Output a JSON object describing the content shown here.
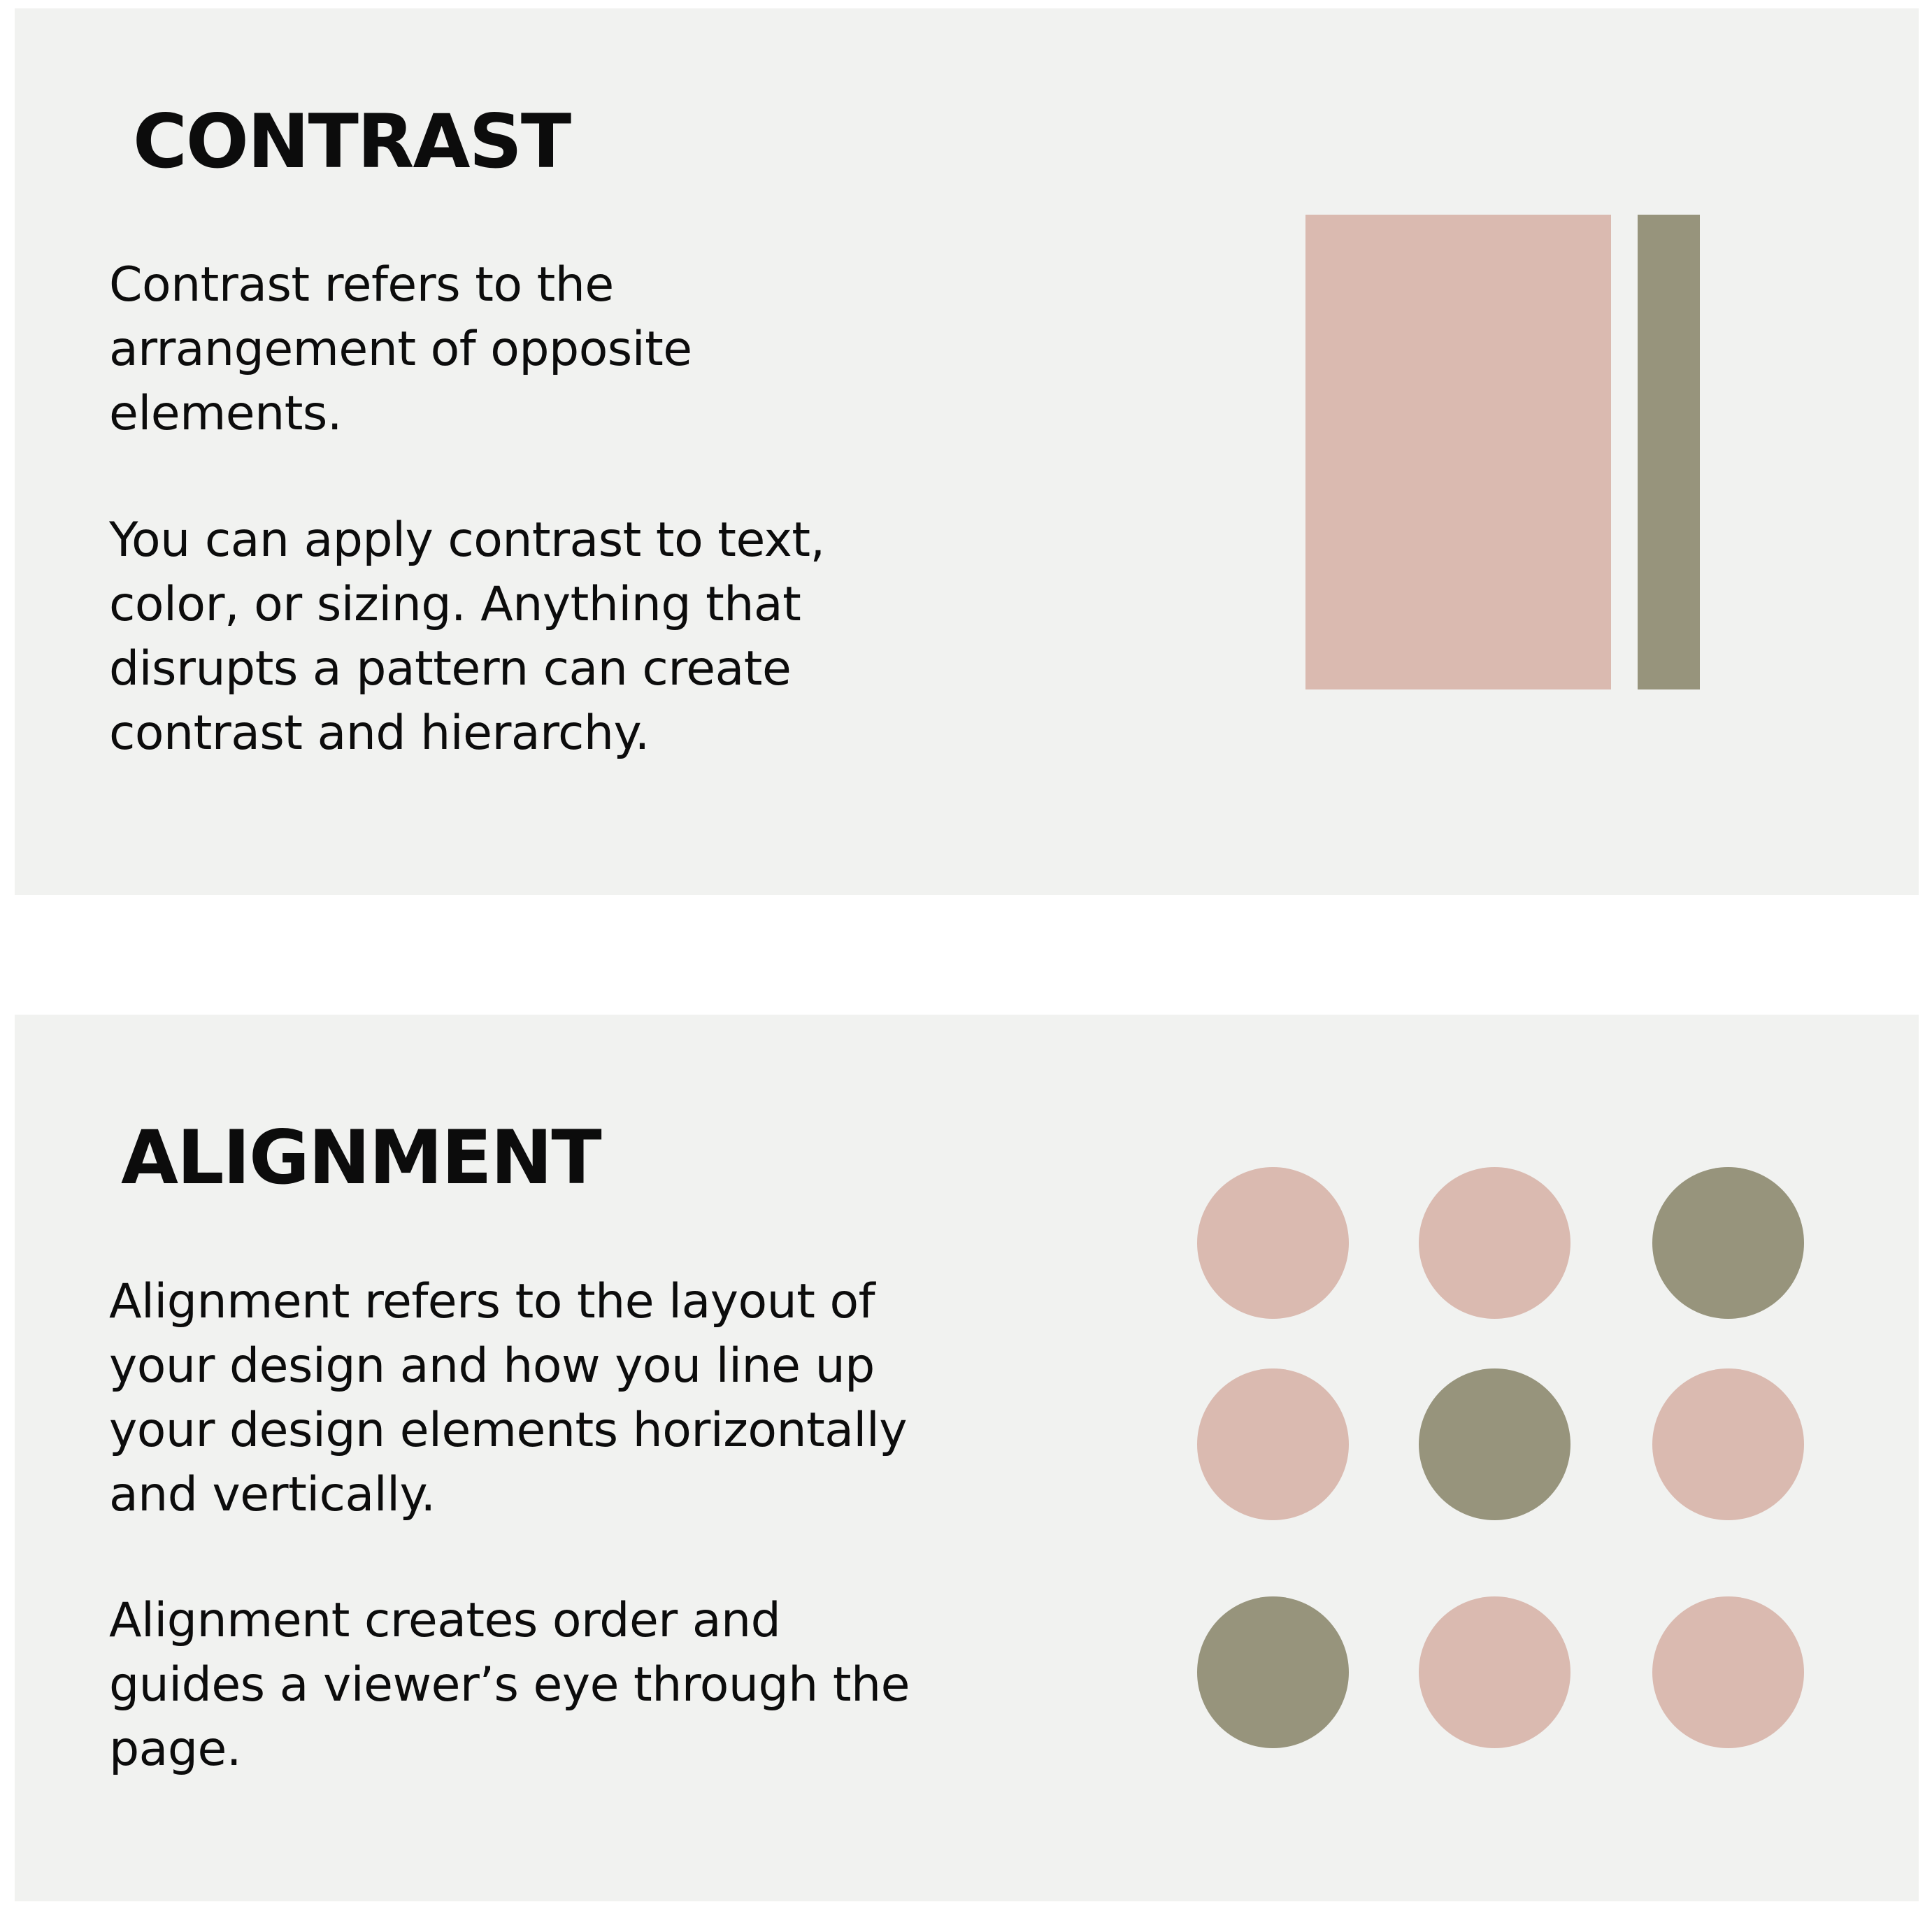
{
  "colors": {
    "panel_background": "#f1f2f0",
    "page_background": "#ffffff",
    "text": "#0c0c0c",
    "pink": "#dabab0",
    "olive": "#97947c"
  },
  "contrast": {
    "heading": "CONTRAST",
    "paragraph_1": "Contrast refers to the arrangement of opposite elements.",
    "paragraph_2": "You can apply contrast to text, color, or sizing. Anything that disrupts a pattern can create contrast and hierarchy.",
    "shapes": [
      "pink",
      "olive"
    ]
  },
  "alignment": {
    "heading": "ALIGNMENT",
    "paragraph_1": "Alignment refers to the layout of your design and how you line up your design elements horizontally and vertically.",
    "paragraph_2": "Alignment creates order and guides a viewer’s eye through the page.",
    "dot_grid": [
      [
        "pink",
        "pink",
        "olive"
      ],
      [
        "pink",
        "olive",
        "pink"
      ],
      [
        "olive",
        "pink",
        "pink"
      ]
    ]
  }
}
